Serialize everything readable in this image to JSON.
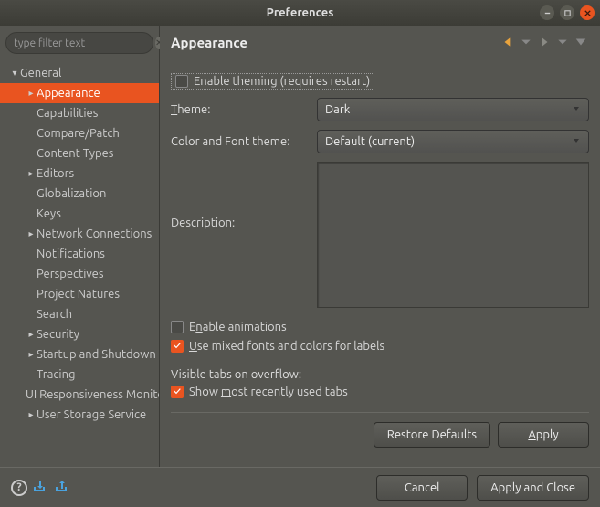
{
  "window": {
    "title": "Preferences"
  },
  "filter": {
    "placeholder": "type filter text"
  },
  "sidebar": {
    "items": [
      {
        "label": "General",
        "expandable": true,
        "expanded": true,
        "depth": 0,
        "selected": false
      },
      {
        "label": "Appearance",
        "expandable": true,
        "expanded": false,
        "depth": 1,
        "selected": true
      },
      {
        "label": "Capabilities",
        "expandable": false,
        "depth": 1,
        "selected": false
      },
      {
        "label": "Compare/Patch",
        "expandable": false,
        "depth": 1,
        "selected": false
      },
      {
        "label": "Content Types",
        "expandable": false,
        "depth": 1,
        "selected": false
      },
      {
        "label": "Editors",
        "expandable": true,
        "expanded": false,
        "depth": 1,
        "selected": false
      },
      {
        "label": "Globalization",
        "expandable": false,
        "depth": 1,
        "selected": false
      },
      {
        "label": "Keys",
        "expandable": false,
        "depth": 1,
        "selected": false
      },
      {
        "label": "Network Connections",
        "expandable": true,
        "expanded": false,
        "depth": 1,
        "selected": false
      },
      {
        "label": "Notifications",
        "expandable": false,
        "depth": 1,
        "selected": false
      },
      {
        "label": "Perspectives",
        "expandable": false,
        "depth": 1,
        "selected": false
      },
      {
        "label": "Project Natures",
        "expandable": false,
        "depth": 1,
        "selected": false
      },
      {
        "label": "Search",
        "expandable": false,
        "depth": 1,
        "selected": false
      },
      {
        "label": "Security",
        "expandable": true,
        "expanded": false,
        "depth": 1,
        "selected": false
      },
      {
        "label": "Startup and Shutdown",
        "expandable": true,
        "expanded": false,
        "depth": 1,
        "selected": false
      },
      {
        "label": "Tracing",
        "expandable": false,
        "depth": 1,
        "selected": false
      },
      {
        "label": "UI Responsiveness Monitoring",
        "expandable": false,
        "depth": 1,
        "selected": false
      },
      {
        "label": "User Storage Service",
        "expandable": true,
        "expanded": false,
        "depth": 1,
        "selected": false
      }
    ]
  },
  "page": {
    "heading": "Appearance",
    "enable_theming": {
      "label": "Enable theming (requires restart)",
      "checked": false
    },
    "theme": {
      "label": "Theme:",
      "value": "Dark"
    },
    "color_font_theme": {
      "label": "Color and Font theme:",
      "value": "Default (current)"
    },
    "description": {
      "label": "Description:",
      "value": ""
    },
    "enable_animations": {
      "label": "Enable animations",
      "checked": false
    },
    "mixed_fonts": {
      "label": "Use mixed fonts and colors for labels",
      "checked": true
    },
    "visible_tabs_heading": "Visible tabs on overflow:",
    "show_mru": {
      "label": "Show most recently used tabs",
      "checked": true
    },
    "restore_defaults": "Restore Defaults",
    "apply": "Apply"
  },
  "footer": {
    "cancel": "Cancel",
    "apply_close": "Apply and Close"
  }
}
